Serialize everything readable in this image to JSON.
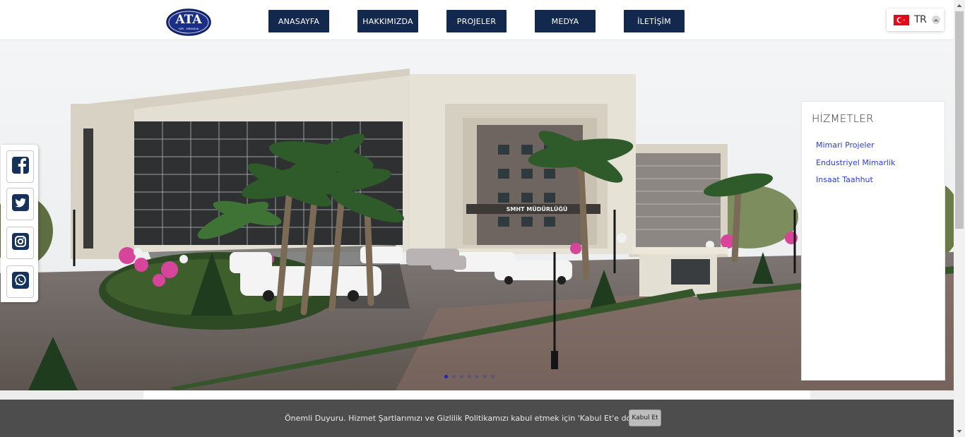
{
  "header": {
    "logo": {
      "name": "ata-logo",
      "letters": "ATA",
      "tagline": "YAPI - MİMARLIK"
    },
    "nav": [
      {
        "label": "ANASAYFA"
      },
      {
        "label": "HAKKIMIZDA"
      },
      {
        "label": "PROJELER"
      },
      {
        "label": "MEDYA"
      },
      {
        "label": "İLETİŞİM"
      }
    ],
    "language": {
      "code": "TR",
      "flag": "turkey-flag-icon",
      "caret": "chevron-up-icon"
    }
  },
  "hero": {
    "building_sign": "SMHT MÜDÜRLÜĞÜ",
    "carousel": {
      "slides": 7,
      "active_index": 0
    }
  },
  "social": [
    {
      "name": "facebook-icon"
    },
    {
      "name": "twitter-icon"
    },
    {
      "name": "instagram-icon"
    },
    {
      "name": "whatsapp-icon"
    }
  ],
  "services": {
    "title": "HİZMETLER",
    "links": [
      {
        "label": "Mimari Projeler"
      },
      {
        "label": "Endustriyel Mimarlik"
      },
      {
        "label": "Insaat Taahhut"
      }
    ]
  },
  "cookie": {
    "message": "Önemli Duyuru. Hizmet Şartlarımızı ve Gizlilik Politikamızı kabul etmek için 'Kabul Et'e dokunun.",
    "accept_label": "Kabul Et"
  },
  "colors": {
    "nav_bg": "#13284d",
    "link": "#2d3ed6",
    "cookie_bg": "#4d4d4d",
    "dot_active": "#1c24c4"
  }
}
